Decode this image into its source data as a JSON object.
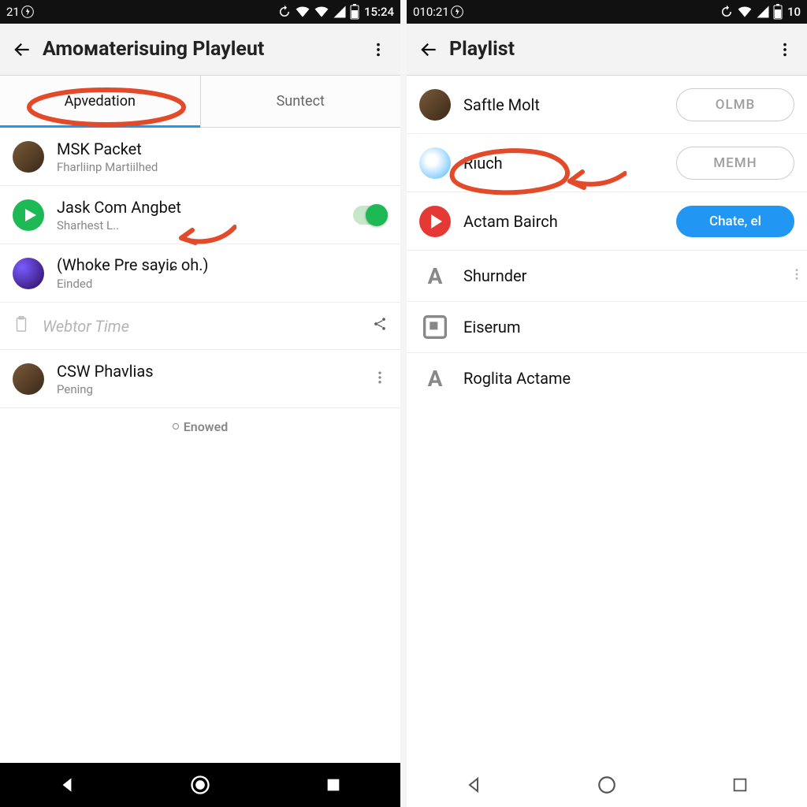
{
  "left": {
    "status": {
      "left_time": "21",
      "right_time": "15:24"
    },
    "appbar": {
      "title": "Amoмaterisuing Playleut"
    },
    "tabs": {
      "active": "Apvedation",
      "inactive": "Suntect"
    },
    "rows": [
      {
        "title": "MSK Packet",
        "sub": "Fharliinp Martiilhed"
      },
      {
        "title": "Jask Com Angbet",
        "sub": "Sharhest L.."
      },
      {
        "title": "(Whoke Pre sayiɕ oh.)",
        "sub": "Einded"
      }
    ],
    "section": "Webtor Time",
    "row4": {
      "title": "CSW Phavlias",
      "sub": "Pening"
    },
    "footer": "Enowed"
  },
  "right": {
    "status": {
      "left_time": "010:21",
      "right_text": "10"
    },
    "appbar": {
      "title": "Playlist"
    },
    "rows": [
      {
        "title": "Saftle Molt",
        "button": "OLMB"
      },
      {
        "title": "Riuch",
        "button": "MEMH"
      },
      {
        "title": "Actam Bairch",
        "button": "Chate, el"
      },
      {
        "title": "Shurnder"
      },
      {
        "title": "Eiserum"
      },
      {
        "title": "Roglita Actame"
      }
    ]
  }
}
